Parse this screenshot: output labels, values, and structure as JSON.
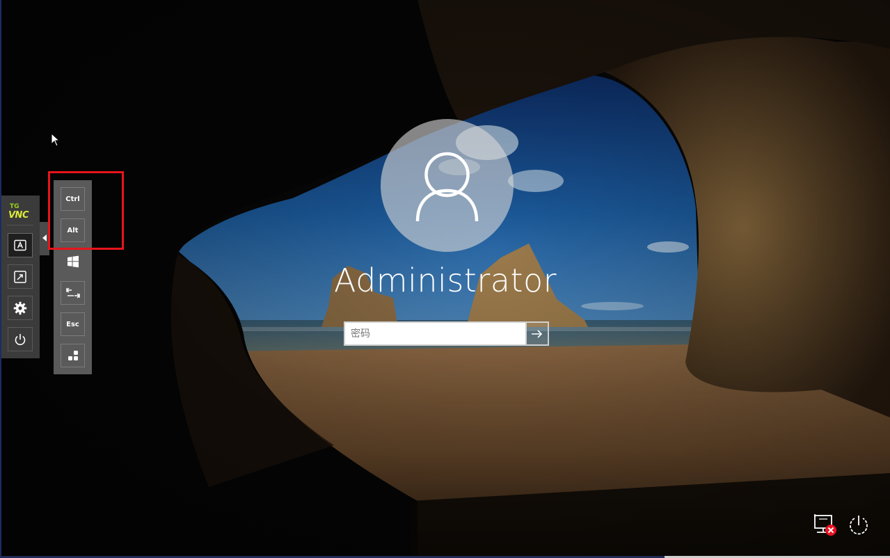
{
  "login": {
    "username": "Administrator",
    "password_placeholder": "密码",
    "password_value": "",
    "submit_icon": "arrow-right-icon",
    "avatar_icon": "user-silhouette-icon"
  },
  "vnc_toolbar": {
    "logo_top": "TG",
    "logo_bottom": "VNC",
    "buttons": [
      {
        "icon": "keyboard-a-icon",
        "active": true
      },
      {
        "icon": "fit-screen-icon"
      },
      {
        "icon": "gear-icon"
      },
      {
        "icon": "power-icon"
      }
    ],
    "expand_icon": "chevron-left-icon"
  },
  "extra_keys": {
    "ctrl": "Ctrl",
    "alt": "Alt",
    "windows_icon": "windows-logo-icon",
    "tab_icon": "tab-icon",
    "esc": "Esc",
    "more_icon": "key-combos-icon"
  },
  "system_icons": {
    "network": "network-disconnected-icon",
    "power": "power-options-icon"
  },
  "colors": {
    "highlight": "#e8141c",
    "toolbar_bg": "#3b3b3b",
    "keys_bg": "#5a5a5a",
    "network_error": "#e81123"
  }
}
